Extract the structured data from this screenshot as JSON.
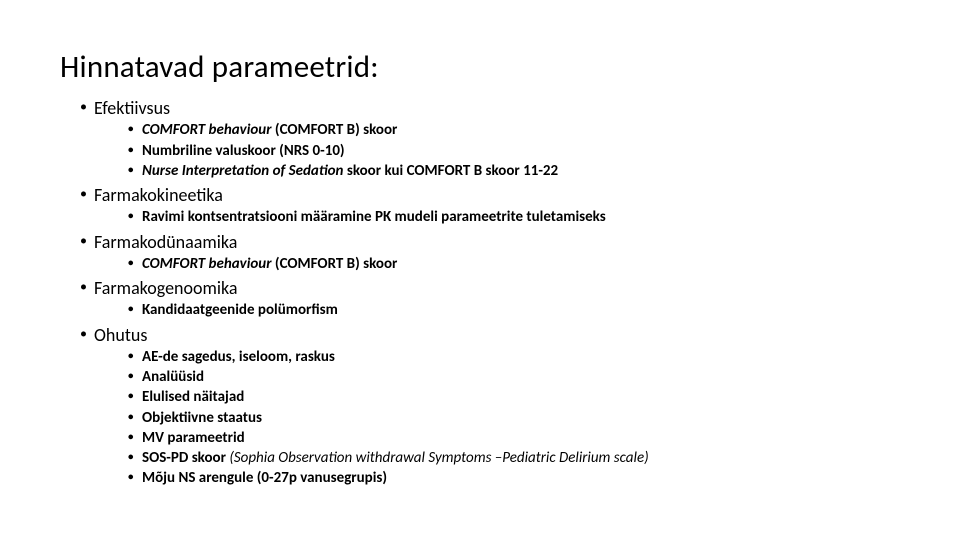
{
  "title": "Hinnatavad parameetrid:",
  "sections": [
    {
      "label": "Efektiivsus",
      "items": [
        {
          "pre_i": "COMFORT behaviour",
          "post": " (COMFORT B) skoor"
        },
        {
          "post": "Numbriline valuskoor (NRS 0-10)"
        },
        {
          "pre_i": "Nurse Interpretation of Sedation",
          "post": " skoor kui COMFORT B skoor 11-22"
        }
      ]
    },
    {
      "label": "Farmakokineetika",
      "items": [
        {
          "post": "Ravimi kontsentratsiooni määramine PK mudeli parameetrite tuletamiseks"
        }
      ]
    },
    {
      "label": "Farmakodünaamika",
      "items": [
        {
          "pre_i": "COMFORT behaviour",
          "post": " (COMFORT B) skoor"
        }
      ]
    },
    {
      "label": "Farmakogenoomika",
      "items": [
        {
          "post": "Kandidaatgeenide polümorfism"
        }
      ]
    },
    {
      "label": "Ohutus",
      "items": [
        {
          "post": "AE-de sagedus, iseloom, raskus"
        },
        {
          "post": "Analüüsid"
        },
        {
          "post": "Elulised näitajad"
        },
        {
          "post": "Objektiivne staatus"
        },
        {
          "post": "MV parameetrid"
        },
        {
          "post": "SOS-PD skoor ",
          "tail_i": "(Sophia Observation withdrawal Symptoms –Pediatric Delirium scale)"
        },
        {
          "post": "Mõju NS arengule (0-27p vanusegrupis)"
        }
      ]
    }
  ]
}
